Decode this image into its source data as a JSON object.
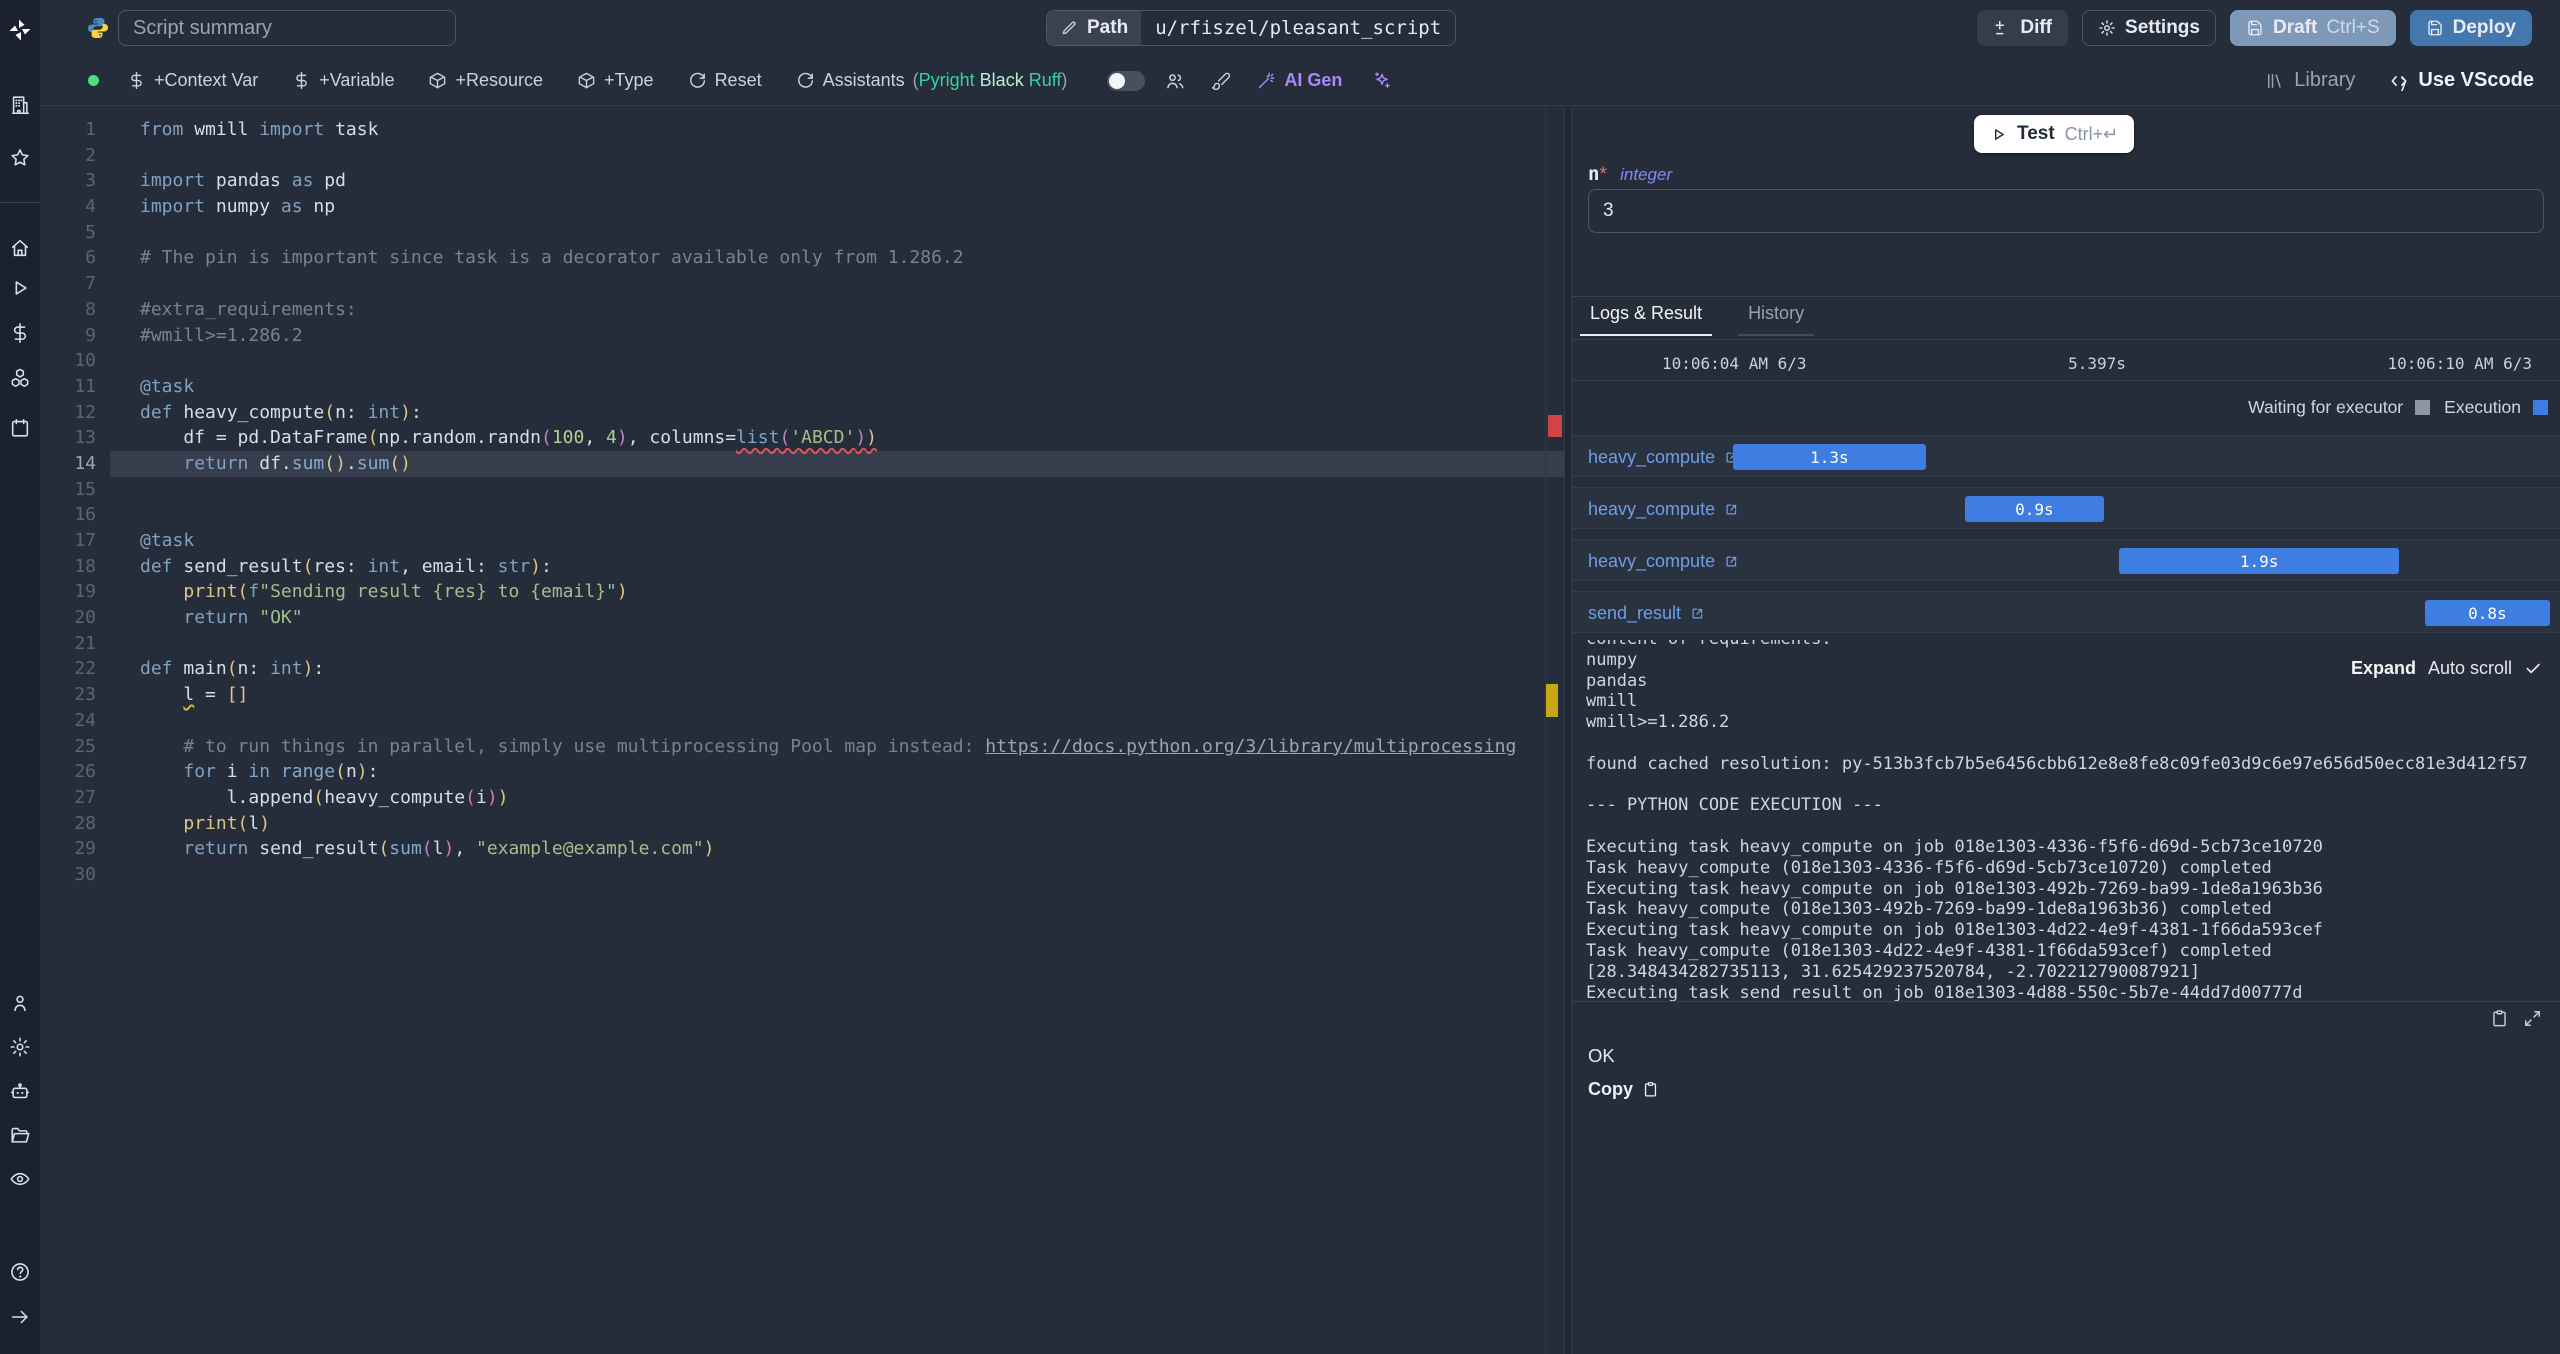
{
  "header": {
    "summary_placeholder": "Script summary",
    "path_label": "Path",
    "path_value": "u/rfiszel/pleasant_script",
    "diff_label": "Diff",
    "settings_label": "Settings",
    "draft_label": "Draft",
    "draft_shortcut": "Ctrl+S",
    "deploy_label": "Deploy"
  },
  "toolbar": {
    "context_var_label": "+Context Var",
    "variable_label": "+Variable",
    "resource_label": "+Resource",
    "type_label": "+Type",
    "reset_label": "Reset",
    "assistants_label": "Assistants",
    "assistants_open": "(",
    "assistants_close": ")",
    "assistants": [
      "Pyright",
      "Black",
      "Ruff"
    ],
    "ai_gen_label": "AI Gen",
    "library_label": "Library",
    "vscode_label": "Use VScode"
  },
  "sidebar": {
    "icons": [
      "building",
      "star",
      "divider",
      "home",
      "play",
      "dollar",
      "boxes",
      "calendar",
      "user",
      "gear",
      "robot",
      "folder",
      "eye",
      "help",
      "arrow-right"
    ]
  },
  "editor": {
    "active_line": 14,
    "lines": [
      [
        [
          "k",
          "from"
        ],
        [
          "t",
          " wmill "
        ],
        [
          "k",
          "import"
        ],
        [
          "t",
          " task"
        ]
      ],
      [],
      [
        [
          "k",
          "import"
        ],
        [
          "t",
          " pandas "
        ],
        [
          "k",
          "as"
        ],
        [
          "t",
          " pd"
        ]
      ],
      [
        [
          "k",
          "import"
        ],
        [
          "t",
          " numpy "
        ],
        [
          "k",
          "as"
        ],
        [
          "t",
          " np"
        ]
      ],
      [],
      [
        [
          "c",
          "# The pin is important since task is a decorator available only from 1.286.2"
        ]
      ],
      [],
      [
        [
          "c",
          "#extra_requirements:"
        ]
      ],
      [
        [
          "c",
          "#wmill>=1.286.2"
        ]
      ],
      [],
      [
        [
          "d",
          "@task"
        ]
      ],
      [
        [
          "k",
          "def"
        ],
        [
          "t",
          " heavy_compute"
        ],
        [
          "b1",
          "("
        ],
        [
          "t",
          "n: "
        ],
        [
          "k",
          "int"
        ],
        [
          "b1",
          ")"
        ],
        [
          "t",
          ":"
        ]
      ],
      [
        [
          "t",
          "    df = pd.DataFrame"
        ],
        [
          "b1",
          "("
        ],
        [
          "t",
          "np.random.randn"
        ],
        [
          "b2",
          "("
        ],
        [
          "n",
          "100"
        ],
        [
          "t",
          ", "
        ],
        [
          "n",
          "4"
        ],
        [
          "b2",
          ")"
        ],
        [
          "t",
          ", columns="
        ],
        [
          "lk|sqr",
          "list"
        ],
        [
          "b2|sqr",
          "("
        ],
        [
          "s|sqr",
          "'ABCD'"
        ],
        [
          "b2|sqr",
          ")"
        ],
        [
          "b1|sqr",
          ")"
        ]
      ],
      [
        [
          "t",
          "    "
        ],
        [
          "k",
          "return"
        ],
        [
          "t",
          " df."
        ],
        [
          "m",
          "sum"
        ],
        [
          "b1",
          "()"
        ],
        [
          "t",
          "."
        ],
        [
          "m",
          "sum"
        ],
        [
          "b1",
          "()"
        ]
      ],
      [],
      [],
      [
        [
          "d",
          "@task"
        ]
      ],
      [
        [
          "k",
          "def"
        ],
        [
          "t",
          " send_result"
        ],
        [
          "b1",
          "("
        ],
        [
          "t",
          "res: "
        ],
        [
          "k",
          "int"
        ],
        [
          "t",
          ", email: "
        ],
        [
          "k",
          "str"
        ],
        [
          "b1",
          ")"
        ],
        [
          "t",
          ":"
        ]
      ],
      [
        [
          "t",
          "    "
        ],
        [
          "f",
          "print"
        ],
        [
          "b1",
          "("
        ],
        [
          "k",
          "f"
        ],
        [
          "s",
          "\"Sending result {res} to {email}\""
        ],
        [
          "b1",
          ")"
        ]
      ],
      [
        [
          "t",
          "    "
        ],
        [
          "k",
          "return"
        ],
        [
          "t",
          " "
        ],
        [
          "s",
          "\"OK\""
        ]
      ],
      [],
      [
        [
          "k",
          "def"
        ],
        [
          "t",
          " main"
        ],
        [
          "b1",
          "("
        ],
        [
          "t",
          "n: "
        ],
        [
          "k",
          "int"
        ],
        [
          "b1",
          ")"
        ],
        [
          "t",
          ":"
        ]
      ],
      [
        [
          "t",
          "    "
        ],
        [
          "t|sqy",
          "l"
        ],
        [
          "t",
          " = "
        ],
        [
          "b1",
          "[]"
        ]
      ],
      [],
      [
        [
          "t",
          "    "
        ],
        [
          "c",
          "# to run things in parallel, simply use multiprocessing Pool map instead: "
        ],
        [
          "u",
          "https://docs.python.org/3/library/multiprocessing"
        ]
      ],
      [
        [
          "t",
          "    "
        ],
        [
          "k",
          "for"
        ],
        [
          "t",
          " i "
        ],
        [
          "k",
          "in"
        ],
        [
          "t",
          " "
        ],
        [
          "m",
          "range"
        ],
        [
          "b1",
          "("
        ],
        [
          "t",
          "n"
        ],
        [
          "b1",
          ")"
        ],
        [
          "t",
          ":"
        ]
      ],
      [
        [
          "t",
          "        l."
        ],
        [
          "t",
          "append"
        ],
        [
          "b1",
          "("
        ],
        [
          "t",
          "heavy_compute"
        ],
        [
          "b2",
          "("
        ],
        [
          "t",
          "i"
        ],
        [
          "b2",
          ")"
        ],
        [
          "b1",
          ")"
        ]
      ],
      [
        [
          "t",
          "    "
        ],
        [
          "f",
          "print"
        ],
        [
          "b1",
          "("
        ],
        [
          "t",
          "l"
        ],
        [
          "b1",
          ")"
        ]
      ],
      [
        [
          "t",
          "    "
        ],
        [
          "k",
          "return"
        ],
        [
          "t",
          " send_result"
        ],
        [
          "b1",
          "("
        ],
        [
          "m",
          "sum"
        ],
        [
          "b2",
          "("
        ],
        [
          "t",
          "l"
        ],
        [
          "b2",
          ")"
        ],
        [
          "t",
          ", "
        ],
        [
          "s",
          "\"example@example.com\""
        ],
        [
          "b1",
          ")"
        ]
      ],
      []
    ]
  },
  "panel": {
    "test_label": "Test",
    "test_shortcut": "Ctrl+↵",
    "arg": {
      "name": "n",
      "required_mark": "*",
      "type": "integer",
      "value": "3"
    },
    "tabs": [
      "Logs & Result",
      "History"
    ],
    "active_tab": "Logs & Result",
    "run": {
      "start": "10:06:04 AM 6/3",
      "duration": "5.397s",
      "end": "10:06:10 AM 6/3"
    },
    "legend": [
      {
        "label": "Waiting for executor",
        "color": "#8e96a3"
      },
      {
        "label": "Execution",
        "color": "#3b7de0"
      }
    ],
    "timeline": [
      {
        "name": "heavy_compute",
        "duration": "1.3s",
        "left_pct": 16.3,
        "width_pct": 19.5
      },
      {
        "name": "heavy_compute",
        "duration": "0.9s",
        "left_pct": 39.8,
        "width_pct": 14.0
      },
      {
        "name": "heavy_compute",
        "duration": "1.9s",
        "left_pct": 55.4,
        "width_pct": 28.3
      },
      {
        "name": "send_result",
        "duration": "0.8s",
        "left_pct": 86.3,
        "width_pct": 12.7
      }
    ],
    "logs": {
      "expand_label": "Expand",
      "autoscroll_label": "Auto scroll",
      "lines": [
        "content of requirements:",
        "numpy",
        "pandas",
        "wmill",
        "wmill>=1.286.2",
        "",
        "found cached resolution: py-513b3fcb7b5e6456cbb612e8e8fe8c09fe03d9c6e97e656d50ecc81e3d412f57",
        "",
        "--- PYTHON CODE EXECUTION ---",
        "",
        "Executing task heavy_compute on job 018e1303-4336-f5f6-d69d-5cb73ce10720",
        "Task heavy_compute (018e1303-4336-f5f6-d69d-5cb73ce10720) completed",
        "Executing task heavy_compute on job 018e1303-492b-7269-ba99-1de8a1963b36",
        "Task heavy_compute (018e1303-492b-7269-ba99-1de8a1963b36) completed",
        "Executing task heavy_compute on job 018e1303-4d22-4e9f-4381-1f66da593cef",
        "Task heavy_compute (018e1303-4d22-4e9f-4381-1f66da593cef) completed",
        "[28.348434282735113, 31.625429237520784, -2.702212790087921]",
        "Executing task send_result on job 018e1303-4d88-550c-5b7e-44dd7d00777d"
      ]
    },
    "result": {
      "value": "OK",
      "copy_label": "Copy"
    }
  }
}
